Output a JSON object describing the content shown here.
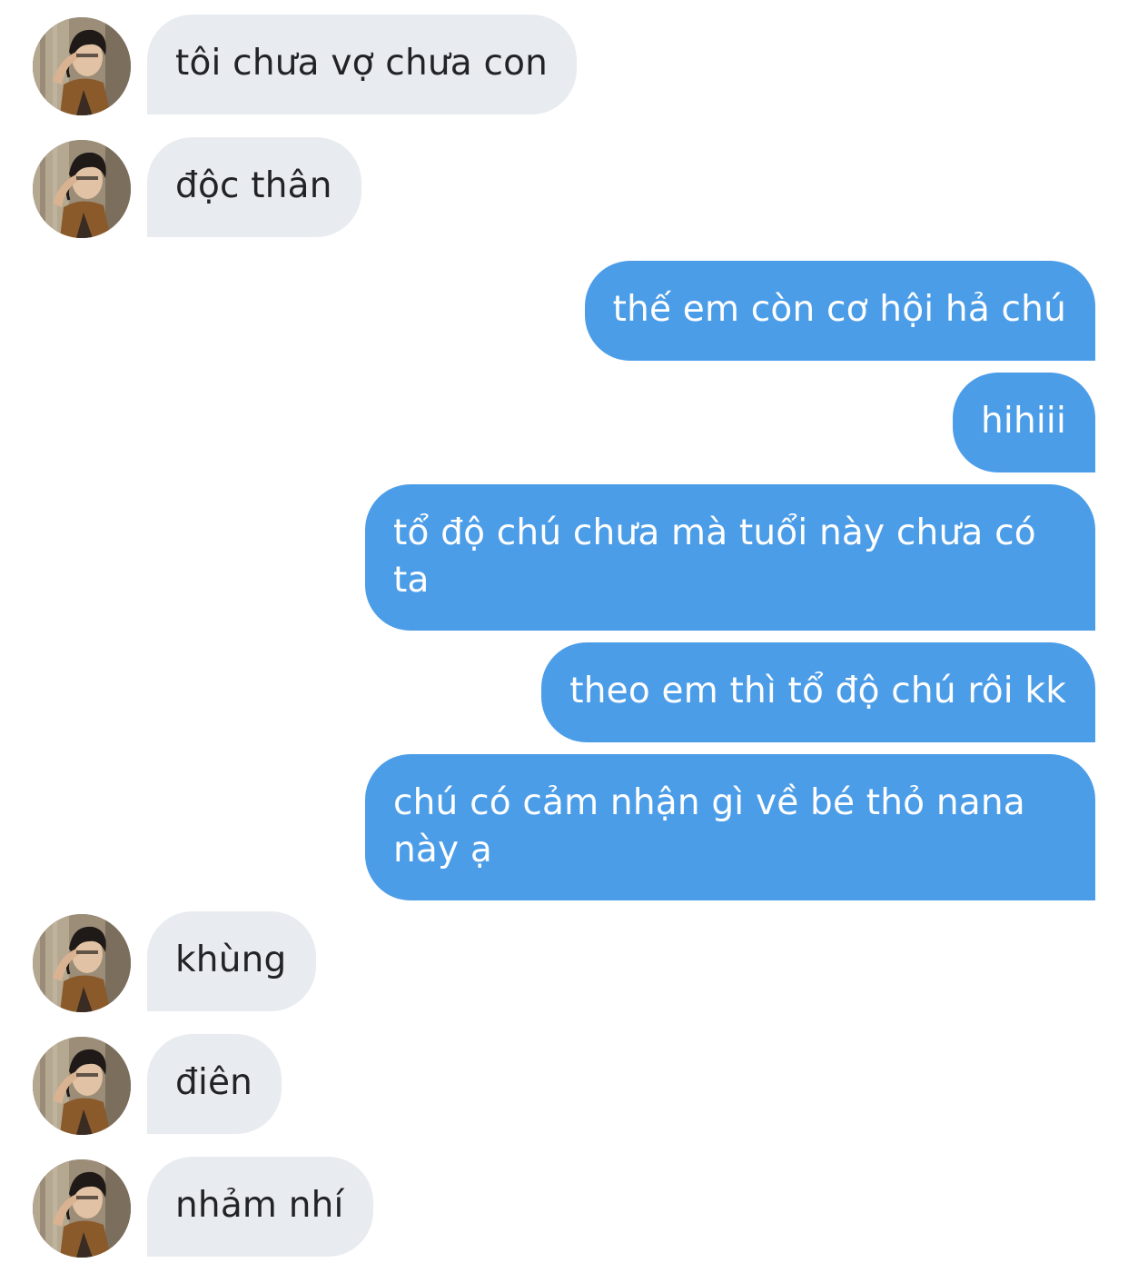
{
  "messages": [
    {
      "side": "in",
      "text": "tôi chưa vợ chưa con"
    },
    {
      "side": "in",
      "text": "độc thân"
    },
    {
      "side": "out",
      "text": "thế em còn cơ hội hả chú"
    },
    {
      "side": "out",
      "text": "hihiii"
    },
    {
      "side": "out",
      "text": "tổ độ chú chưa mà tuổi này chưa có ta"
    },
    {
      "side": "out",
      "text": "theo em thì tổ độ chú rôi kk"
    },
    {
      "side": "out",
      "text": "chú có cảm nhận gì về bé thỏ nana này ạ"
    },
    {
      "side": "in",
      "text": "khùng"
    },
    {
      "side": "in",
      "text": "điên"
    },
    {
      "side": "in",
      "text": "nhảm nhí"
    }
  ],
  "colors": {
    "incoming_bubble": "#e8ebef",
    "incoming_text": "#222326",
    "outgoing_bubble": "#4c9de8",
    "outgoing_text": "#ffffff"
  },
  "icons": {
    "contact_avatar": "person-avatar-photo"
  }
}
